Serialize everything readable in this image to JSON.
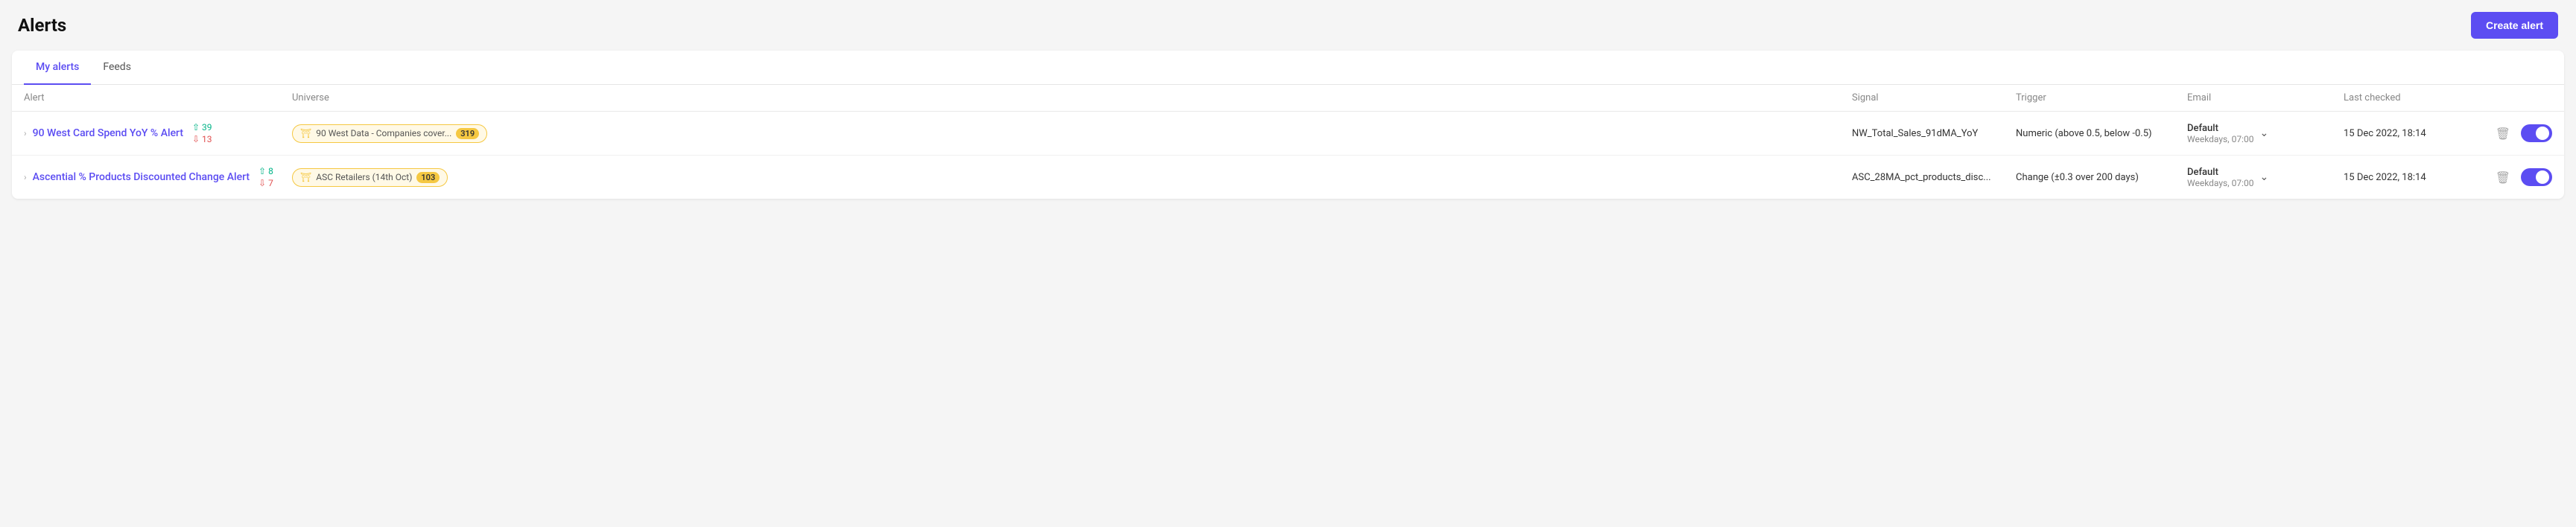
{
  "page": {
    "title": "Alerts",
    "create_button": "Create alert"
  },
  "tabs": [
    {
      "id": "my-alerts",
      "label": "My alerts",
      "active": true
    },
    {
      "id": "feeds",
      "label": "Feeds",
      "active": false
    }
  ],
  "table": {
    "columns": [
      "Alert",
      "Universe",
      "Signal",
      "Trigger",
      "Email",
      "Last checked",
      ""
    ],
    "rows": [
      {
        "id": "row-1",
        "alert_name": "90 West Card Spend YoY % Alert",
        "count_up": "39",
        "count_down": "13",
        "universe_label": "90 West Data - Companies cover...",
        "universe_count": "319",
        "signal": "NW_Total_Sales_91dMA_YoY",
        "trigger": "Numeric (above 0.5, below -0.5)",
        "email_label": "Default",
        "email_time": "Weekdays, 07:00",
        "last_checked": "15 Dec 2022, 18:14",
        "enabled": true
      },
      {
        "id": "row-2",
        "alert_name": "Ascential % Products Discounted Change Alert",
        "count_up": "8",
        "count_down": "7",
        "universe_label": "ASC Retailers (14th Oct)",
        "universe_count": "103",
        "signal": "ASC_28MA_pct_products_disc...",
        "trigger": "Change (±0.3 over 200 days)",
        "email_label": "Default",
        "email_time": "Weekdays, 07:00",
        "last_checked": "15 Dec 2022, 18:14",
        "enabled": true
      }
    ]
  }
}
